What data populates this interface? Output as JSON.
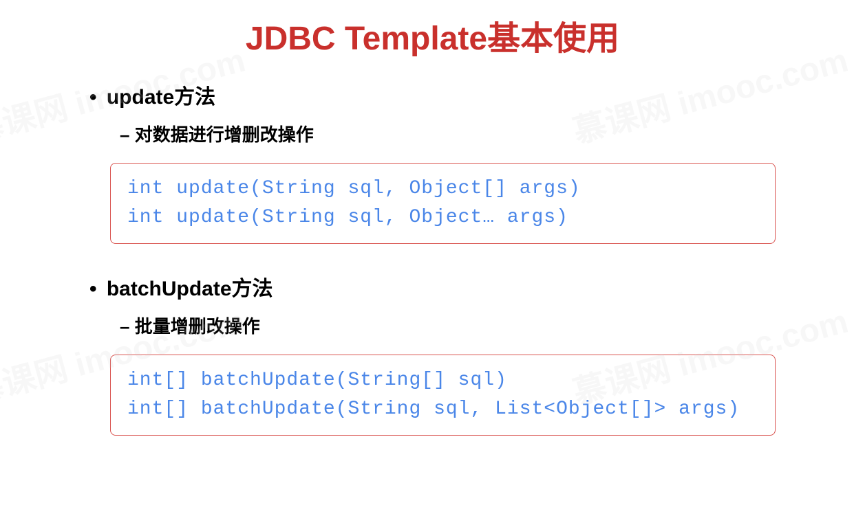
{
  "title": "JDBC Template基本使用",
  "watermark": "慕课网 imooc.com",
  "sections": [
    {
      "heading": "update方法",
      "subheading": "对数据进行增删改操作",
      "code": [
        "int update(String sql, Object[] args)",
        "int update(String sql, Object… args)"
      ]
    },
    {
      "heading": "batchUpdate方法",
      "subheading": "批量增删改操作",
      "code": [
        "int[] batchUpdate(String[] sql)",
        "int[] batchUpdate(String sql, List<Object[]> args)"
      ]
    }
  ]
}
